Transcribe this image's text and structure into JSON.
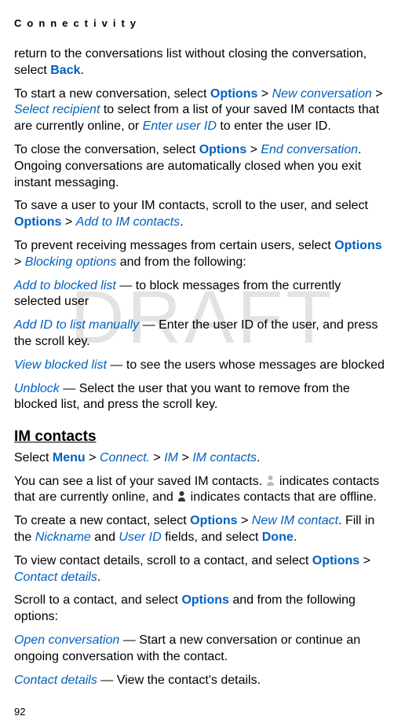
{
  "header": "Connectivity",
  "watermark": "DRAFT",
  "pageNumber": "92",
  "p1": {
    "t1": "return to the conversations list without closing the conversation, select ",
    "back": "Back",
    "t2": "."
  },
  "p2": {
    "t1": "To start a new conversation, select ",
    "options": "Options",
    "gt": " > ",
    "newconv": "New conversation",
    "selrecip": "Select recipient",
    "t2": " to select from a list of your saved IM contacts that are currently online, or ",
    "enterid": "Enter user ID",
    "t3": " to enter the user ID."
  },
  "p3": {
    "t1": "To close the conversation, select ",
    "options": "Options",
    "gt": " > ",
    "endconv": "End conversation",
    "t2": ". Ongoing conversations are automatically closed when you exit instant messaging."
  },
  "p4": {
    "t1": "To save a user to your IM contacts, scroll to the user, and select ",
    "options": "Options",
    "gt": " > ",
    "addim": "Add to IM contacts",
    "t2": "."
  },
  "p5": {
    "t1": "To prevent receiving messages from certain users, select ",
    "options": "Options",
    "gt": " > ",
    "blocking": "Blocking options",
    "t2": " and from the following:"
  },
  "p6": {
    "lead": "Add to blocked list",
    "rest": " — to block messages from the currently selected user"
  },
  "p7": {
    "lead": "Add ID to list manually",
    "rest": " — Enter the user ID of the user, and press the scroll key."
  },
  "p8": {
    "lead": "View blocked list",
    "rest": " — to see the users whose messages are blocked"
  },
  "p9": {
    "lead": "Unblock",
    "rest": " — Select the user that you want to remove from the blocked list, and press the scroll key."
  },
  "section": "IM contacts",
  "p10": {
    "t1": "Select ",
    "menu": "Menu",
    "gt": " > ",
    "connect": "Connect.",
    "im": "IM",
    "imc": "IM contacts",
    "t2": "."
  },
  "p11": {
    "t1": "You can see a list of your saved IM contacts. ",
    "t2": " indicates contacts that are currently online, and ",
    "t3": " indicates contacts that are offline."
  },
  "p12": {
    "t1": "To create a new contact, select ",
    "options": "Options",
    "gt": " > ",
    "newimc": "New IM contact",
    "t2": ". Fill in the ",
    "nickname": "Nickname",
    "t3": " and ",
    "userid": "User ID",
    "t4": " fields, and select ",
    "done": "Done",
    "t5": "."
  },
  "p13": {
    "t1": "To view contact details, scroll to a contact, and select ",
    "options": "Options",
    "gt": " > ",
    "cdetails": "Contact details",
    "t2": "."
  },
  "p14": {
    "t1": "Scroll to a contact, and select ",
    "options": "Options",
    "t2": " and from the following options:"
  },
  "p15": {
    "lead": "Open conversation",
    "rest": " — Start a new conversation or continue an ongoing conversation with the contact."
  },
  "p16": {
    "lead": "Contact details",
    "rest": " — View the contact's details."
  }
}
